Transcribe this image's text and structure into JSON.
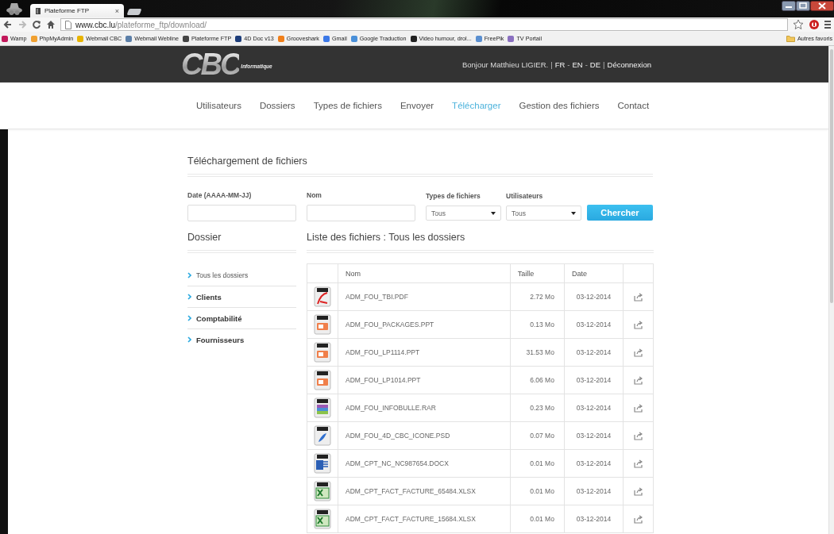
{
  "browser": {
    "tab_title": "Plateforme FTP",
    "tab_close": "×",
    "url_host": "www.cbc.lu",
    "url_path": "/plateforme_ftp/download/",
    "bookmarks": [
      {
        "label": "Wamp",
        "color": "#c2185b"
      },
      {
        "label": "PhpMyAdmin",
        "color": "#f0a030"
      },
      {
        "label": "Webmail CBC",
        "color": "#e8b400"
      },
      {
        "label": "Webmail Webline",
        "color": "#5b7fa8"
      },
      {
        "label": "Plateforme FTP",
        "color": "#444444"
      },
      {
        "label": "4D Doc v13",
        "color": "#1d3d7a"
      },
      {
        "label": "Grooveshark",
        "color": "#f07f1a"
      },
      {
        "label": "Gmail",
        "color": "#3b78e7"
      },
      {
        "label": "Google Traduction",
        "color": "#4a90d9"
      },
      {
        "label": "Video humour, drol...",
        "color": "#222222"
      },
      {
        "label": "FreePik",
        "color": "#5a8fd0"
      },
      {
        "label": "TV Portail",
        "color": "#8a6fc0"
      }
    ],
    "other_bookmarks": "Autres favoris"
  },
  "header": {
    "logo": "CBC",
    "logo_tagline": "Informatique",
    "user_bar": [
      {
        "kind": "text",
        "text": "Bonjour Matthieu LIGIER."
      },
      {
        "kind": "sep",
        "text": "|"
      },
      {
        "kind": "link",
        "text": "FR"
      },
      {
        "kind": "sep",
        "text": "-"
      },
      {
        "kind": "link",
        "text": "EN"
      },
      {
        "kind": "sep",
        "text": "-"
      },
      {
        "kind": "link",
        "text": "DE"
      },
      {
        "kind": "sep",
        "text": "|"
      },
      {
        "kind": "link",
        "text": "Déconnexion"
      }
    ]
  },
  "nav": [
    {
      "label": "Utilisateurs",
      "selected": false
    },
    {
      "label": "Dossiers",
      "selected": false
    },
    {
      "label": "Types de fichiers",
      "selected": false
    },
    {
      "label": "Envoyer",
      "selected": false
    },
    {
      "label": "Télécharger",
      "selected": true
    },
    {
      "label": "Gestion des fichiers",
      "selected": false
    },
    {
      "label": "Contact",
      "selected": false
    }
  ],
  "page_title": "Téléchargement de fichiers",
  "search": {
    "fields": [
      {
        "kind": "input",
        "label": "Date (AAAA-MM-JJ)"
      },
      {
        "kind": "input",
        "label": "Nom"
      },
      {
        "kind": "select",
        "label": "Types de fichiers",
        "value": "Tous"
      },
      {
        "kind": "select",
        "label": "Utilisateurs",
        "value": "Tous"
      }
    ],
    "button": "Chercher"
  },
  "folders": {
    "title": "Dossier",
    "items": [
      {
        "label": "Tous les dossiers",
        "selected": true
      },
      {
        "label": "Clients",
        "selected": false
      },
      {
        "label": "Comptabilité",
        "selected": false
      },
      {
        "label": "Fournisseurs",
        "selected": false
      }
    ]
  },
  "files": {
    "title": "Liste des fichiers : Tous les dossiers",
    "columns": [
      "Nom",
      "Taille",
      "Date"
    ],
    "rows": [
      {
        "kind": "pdf",
        "name": "ADM_FOU_TBI.PDF",
        "size": "2.72 Mo",
        "date": "03-12-2014"
      },
      {
        "kind": "ppt",
        "name": "ADM_FOU_PACKAGES.PPT",
        "size": "0.13 Mo",
        "date": "03-12-2014"
      },
      {
        "kind": "ppt",
        "name": "ADM_FOU_LP1114.PPT",
        "size": "31.53 Mo",
        "date": "03-12-2014"
      },
      {
        "kind": "ppt",
        "name": "ADM_FOU_LP1014.PPT",
        "size": "6.06 Mo",
        "date": "03-12-2014"
      },
      {
        "kind": "rar",
        "name": "ADM_FOU_INFOBULLE.RAR",
        "size": "0.23 Mo",
        "date": "03-12-2014"
      },
      {
        "kind": "psd",
        "name": "ADM_FOU_4D_CBC_ICONE.PSD",
        "size": "0.07 Mo",
        "date": "03-12-2014"
      },
      {
        "kind": "docx",
        "name": "ADM_CPT_NC_NC987654.DOCX",
        "size": "0.01 Mo",
        "date": "03-12-2014"
      },
      {
        "kind": "xlsx",
        "name": "ADM_CPT_FACT_FACTURE_65484.XLSX",
        "size": "0.01 Mo",
        "date": "03-12-2014"
      },
      {
        "kind": "xlsx",
        "name": "ADM_CPT_FACT_FACTURE_15684.XLSX",
        "size": "0.01 Mo",
        "date": "03-12-2014"
      }
    ]
  }
}
